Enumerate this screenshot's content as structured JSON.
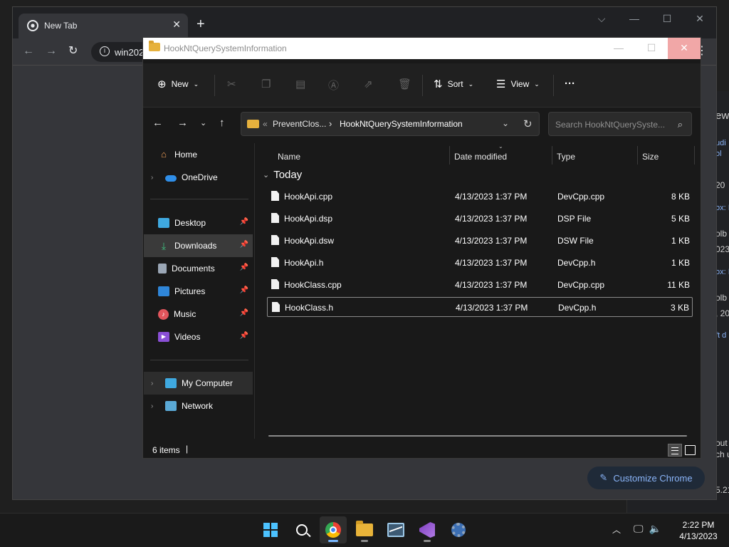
{
  "chrome": {
    "tab_title": "New Tab",
    "omnibox_text": "win202",
    "customize_label": "Customize Chrome"
  },
  "background_page": {
    "snippets": [
      "ew",
      "udi",
      "ol",
      "20",
      "ox: I",
      "olb",
      "023",
      "ox: I",
      "olb",
      ", 20",
      "ft d",
      "out",
      "ch u",
      "5.21"
    ]
  },
  "explorer": {
    "title": "HookNtQuerySystemInformation",
    "commands": {
      "new_label": "New",
      "sort_label": "Sort",
      "view_label": "View",
      "more_label": "···"
    },
    "address": {
      "overflow": "«",
      "segment_parent": "PreventClos...",
      "segment_current": "HookNtQuerySystemInformation"
    },
    "search_placeholder": "Search HookNtQuerySyste...",
    "sidebar": [
      {
        "label": "Home",
        "icon": "home-icon",
        "expandable": false,
        "pinned": false
      },
      {
        "label": "OneDrive",
        "icon": "onedrive-icon",
        "expandable": true,
        "pinned": false
      },
      {
        "label": "Desktop",
        "icon": "desktop-icon",
        "expandable": false,
        "pinned": true
      },
      {
        "label": "Downloads",
        "icon": "downloads-icon",
        "expandable": false,
        "pinned": true,
        "selected": true
      },
      {
        "label": "Documents",
        "icon": "documents-icon",
        "expandable": false,
        "pinned": true
      },
      {
        "label": "Pictures",
        "icon": "pictures-icon",
        "expandable": false,
        "pinned": true
      },
      {
        "label": "Music",
        "icon": "music-icon",
        "expandable": false,
        "pinned": true
      },
      {
        "label": "Videos",
        "icon": "videos-icon",
        "expandable": false,
        "pinned": true
      },
      {
        "label": "My Computer",
        "icon": "computer-icon",
        "expandable": true,
        "pinned": false,
        "hover": true
      },
      {
        "label": "Network",
        "icon": "network-icon",
        "expandable": true,
        "pinned": false
      }
    ],
    "columns": {
      "name": "Name",
      "date": "Date modified",
      "type": "Type",
      "size": "Size"
    },
    "group_label": "Today",
    "files": [
      {
        "name": "HookApi.cpp",
        "date": "4/13/2023 1:37 PM",
        "type": "DevCpp.cpp",
        "size": "8 KB"
      },
      {
        "name": "HookApi.dsp",
        "date": "4/13/2023 1:37 PM",
        "type": "DSP File",
        "size": "5 KB"
      },
      {
        "name": "HookApi.dsw",
        "date": "4/13/2023 1:37 PM",
        "type": "DSW File",
        "size": "1 KB"
      },
      {
        "name": "HookApi.h",
        "date": "4/13/2023 1:37 PM",
        "type": "DevCpp.h",
        "size": "1 KB"
      },
      {
        "name": "HookClass.cpp",
        "date": "4/13/2023 1:37 PM",
        "type": "DevCpp.cpp",
        "size": "11 KB"
      },
      {
        "name": "HookClass.h",
        "date": "4/13/2023 1:37 PM",
        "type": "DevCpp.h",
        "size": "3 KB",
        "focused": true
      }
    ],
    "status_count": "6 items"
  },
  "taskbar": {
    "apps": [
      "start-icon",
      "search-icon",
      "chrome-icon",
      "file-explorer-icon",
      "performance-monitor-icon",
      "visual-studio-icon",
      "settings-icon"
    ],
    "clock_time": "2:22 PM",
    "clock_date": "4/13/2023"
  },
  "colors": {
    "accent": "#4cc2ff",
    "link": "#8ab4f8",
    "explorer_bg": "#191919",
    "selection": "#3a3a3a"
  }
}
